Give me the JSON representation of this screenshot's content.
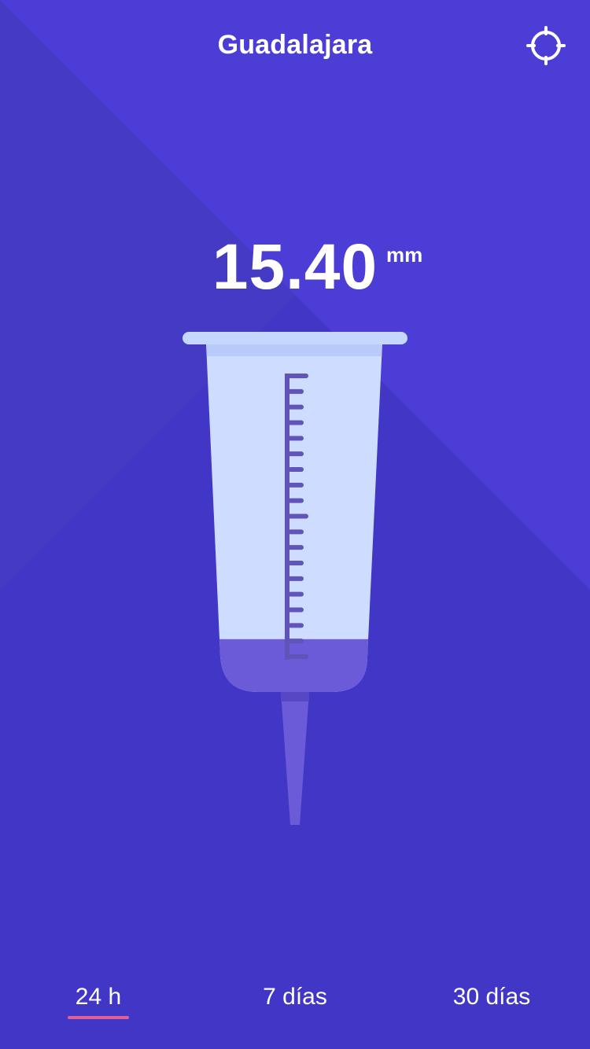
{
  "header": {
    "city": "Guadalajara",
    "locate_icon": "crosshair-icon"
  },
  "reading": {
    "value": "15.40",
    "unit": "mm",
    "fill_level": 0.12
  },
  "tabs": [
    {
      "label": "24 h",
      "selected": true
    },
    {
      "label": "7 días",
      "selected": false
    },
    {
      "label": "30 días",
      "selected": false
    }
  ],
  "colors": {
    "background": "#4136c6",
    "background_light": "#4b3dd5",
    "background_dark": "#3d33b7",
    "gauge_body": "#cddcff",
    "gauge_rim": "#b8caf9",
    "liquid": "#6b5bd9",
    "scale": "#6054b8",
    "tab_indicator": "#e0609c"
  }
}
